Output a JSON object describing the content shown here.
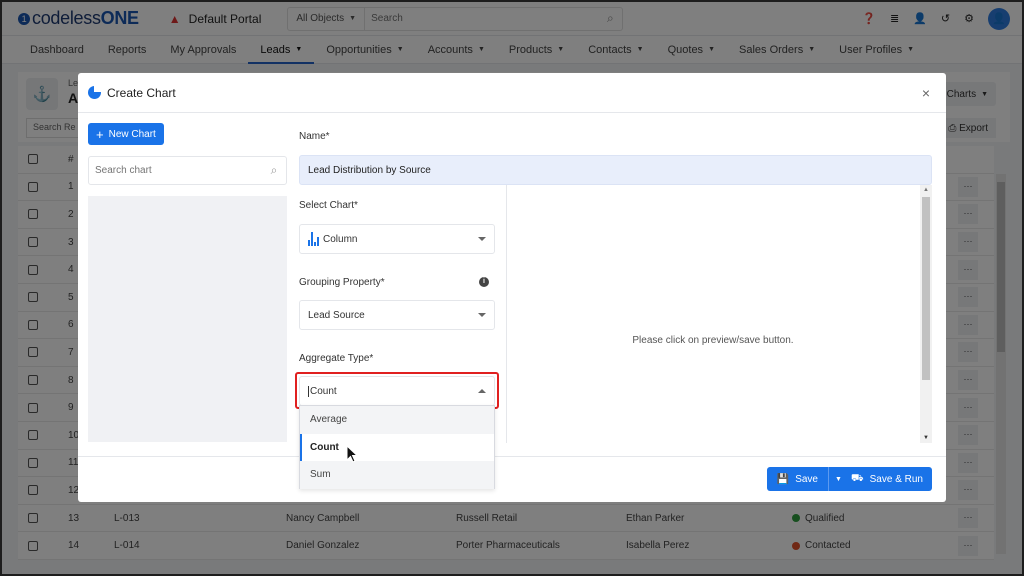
{
  "app": {
    "logo_text": "codeless",
    "logo_suffix": "ONE",
    "portal_name": "Default Portal",
    "search_scope": "All Objects",
    "search_placeholder": "Search",
    "top_icons": [
      "help-icon",
      "database-icon",
      "add-user-icon",
      "history-icon",
      "gear-icon",
      "user-avatar"
    ]
  },
  "nav": {
    "items": [
      {
        "label": "Dashboard",
        "dropdown": false
      },
      {
        "label": "Reports",
        "dropdown": false
      },
      {
        "label": "My Approvals",
        "dropdown": false
      },
      {
        "label": "Leads",
        "dropdown": true,
        "active": true
      },
      {
        "label": "Opportunities",
        "dropdown": true
      },
      {
        "label": "Accounts",
        "dropdown": true
      },
      {
        "label": "Products",
        "dropdown": true
      },
      {
        "label": "Contacts",
        "dropdown": true
      },
      {
        "label": "Quotes",
        "dropdown": true
      },
      {
        "label": "Sales Orders",
        "dropdown": true
      },
      {
        "label": "User Profiles",
        "dropdown": true
      }
    ]
  },
  "background_page": {
    "breadcrumb": "Le",
    "title": "A",
    "charts_button": "Charts",
    "search_placeholder": "Search Re",
    "export_button": "Export",
    "table_header_num": "#",
    "rows": [
      {
        "num": "1"
      },
      {
        "num": "2"
      },
      {
        "num": "3"
      },
      {
        "num": "4"
      },
      {
        "num": "5"
      },
      {
        "num": "6"
      },
      {
        "num": "7"
      },
      {
        "num": "8"
      },
      {
        "num": "9"
      },
      {
        "num": "10"
      },
      {
        "num": "11"
      },
      {
        "num": "12"
      },
      {
        "num": "13",
        "id": "L-013",
        "name": "Nancy Campbell",
        "account": "Russell Retail",
        "owner": "Ethan Parker",
        "status": "Qualified",
        "status_color": "#2e9e3e"
      },
      {
        "num": "14",
        "id": "L-014",
        "name": "Daniel Gonzalez",
        "account": "Porter Pharmaceuticals",
        "owner": "Isabella Perez",
        "status": "Contacted",
        "status_color": "#e0502a"
      }
    ],
    "more_label": "···"
  },
  "modal": {
    "title": "Create Chart",
    "close_label": "×",
    "new_chart_label": "New Chart",
    "search_chart_placeholder": "Search chart",
    "name_label": "Name*",
    "name_value": "Lead Distribution by Source",
    "select_chart_label": "Select Chart*",
    "select_chart_value": "Column",
    "grouping_label": "Grouping Property*",
    "grouping_value": "Lead Source",
    "aggregate_label": "Aggregate Type*",
    "aggregate_value": "Count",
    "aggregate_options": [
      "Average",
      "Count",
      "Sum"
    ],
    "aggregate_selected": "Count",
    "preview_message": "Please click on preview/save button.",
    "save_label": "Save",
    "save_run_label": "Save & Run"
  },
  "colors": {
    "primary": "#1a73e8",
    "highlight": "#e02020",
    "name_field_bg": "#e8eefb"
  }
}
